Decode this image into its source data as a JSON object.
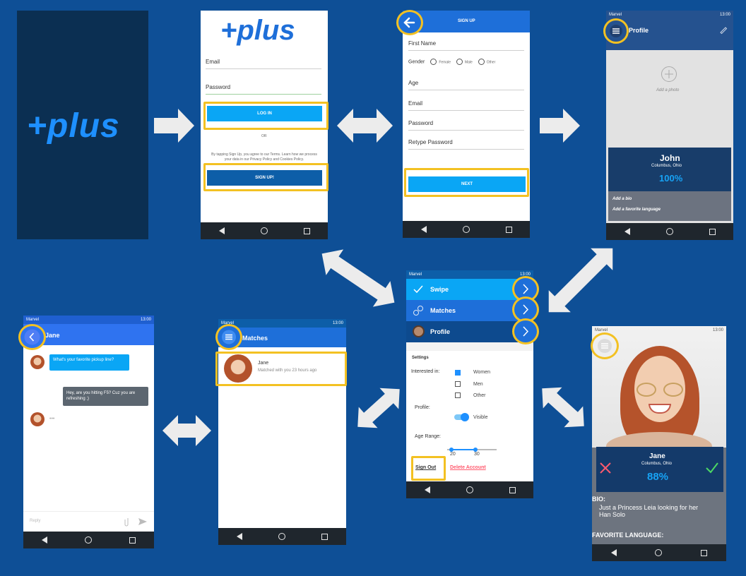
{
  "splash": {
    "logo": "+plus"
  },
  "login": {
    "logo": "+plus",
    "email_label": "Email",
    "password_label": "Password",
    "login_button": "LOG IN",
    "or_text": "OR",
    "terms_text": "By tapping Sign Up, you agree to our Terms. Learn how we process your data in our Privacy Policy and Cookies Policy.",
    "signup_button": "SIGN UP!"
  },
  "signup": {
    "title": "SIGN UP",
    "first_name": "First Name",
    "gender_label": "Gender",
    "gender_options": [
      "Female",
      "Male",
      "Other"
    ],
    "age": "Age",
    "email": "Email",
    "password": "Password",
    "retype_password": "Retype Password",
    "next_button": "NEXT"
  },
  "profile": {
    "status_left": "Marvel",
    "status_right": "13:00",
    "title": "Profile",
    "add_photo": "Add a photo",
    "name": "John",
    "location": "Columbus, Ohio",
    "percent": "100%",
    "add_bio": "Add a bio",
    "add_language": "Add a favorite language"
  },
  "menu": {
    "status_left": "Marvel",
    "status_right": "13:00",
    "items": [
      {
        "label": "Swipe",
        "icon": "checkmark-icon"
      },
      {
        "label": "Matches",
        "icon": "link-icon"
      },
      {
        "label": "Profile",
        "icon": "avatar-icon"
      }
    ],
    "settings_title": "Settings",
    "interested_label": "Interested in:",
    "options": [
      "Women",
      "Men",
      "Other"
    ],
    "profile_label": "Profile:",
    "visible_label": "Visible",
    "age_range_label": "Age Range:",
    "age_min": "20",
    "age_max": "30",
    "sign_out": "Sign Out",
    "delete_account": "Delete Account"
  },
  "chat": {
    "status_left": "Marvel",
    "status_right": "13:00",
    "contact": "Jane",
    "msg1": "What's your favorite pickup line?",
    "msg2": "Hey, are you hitting F5? Cuz you are refreshing ;)",
    "typing": "•••",
    "reply_placeholder": "Reply"
  },
  "matches": {
    "status_left": "Marvel",
    "status_right": "13:00",
    "title": "Matches",
    "match_name": "Jane",
    "match_sub": "Matched with you 23 hours ago"
  },
  "swipe": {
    "status_left": "Marvel",
    "status_right": "13:00",
    "name": "Jane",
    "location": "Columbus, Ohio",
    "percent": "88%",
    "bio_label": "BIO:",
    "bio_text": "Just a Princess Leia looking for her Han Solo",
    "fav_label": "FAVORITE LANGUAGE:"
  },
  "colors": {
    "background": "#0e4f96",
    "brand_blue": "#1e6fd9",
    "button_cyan": "#0aa6f5",
    "highlight": "#f3c122"
  }
}
